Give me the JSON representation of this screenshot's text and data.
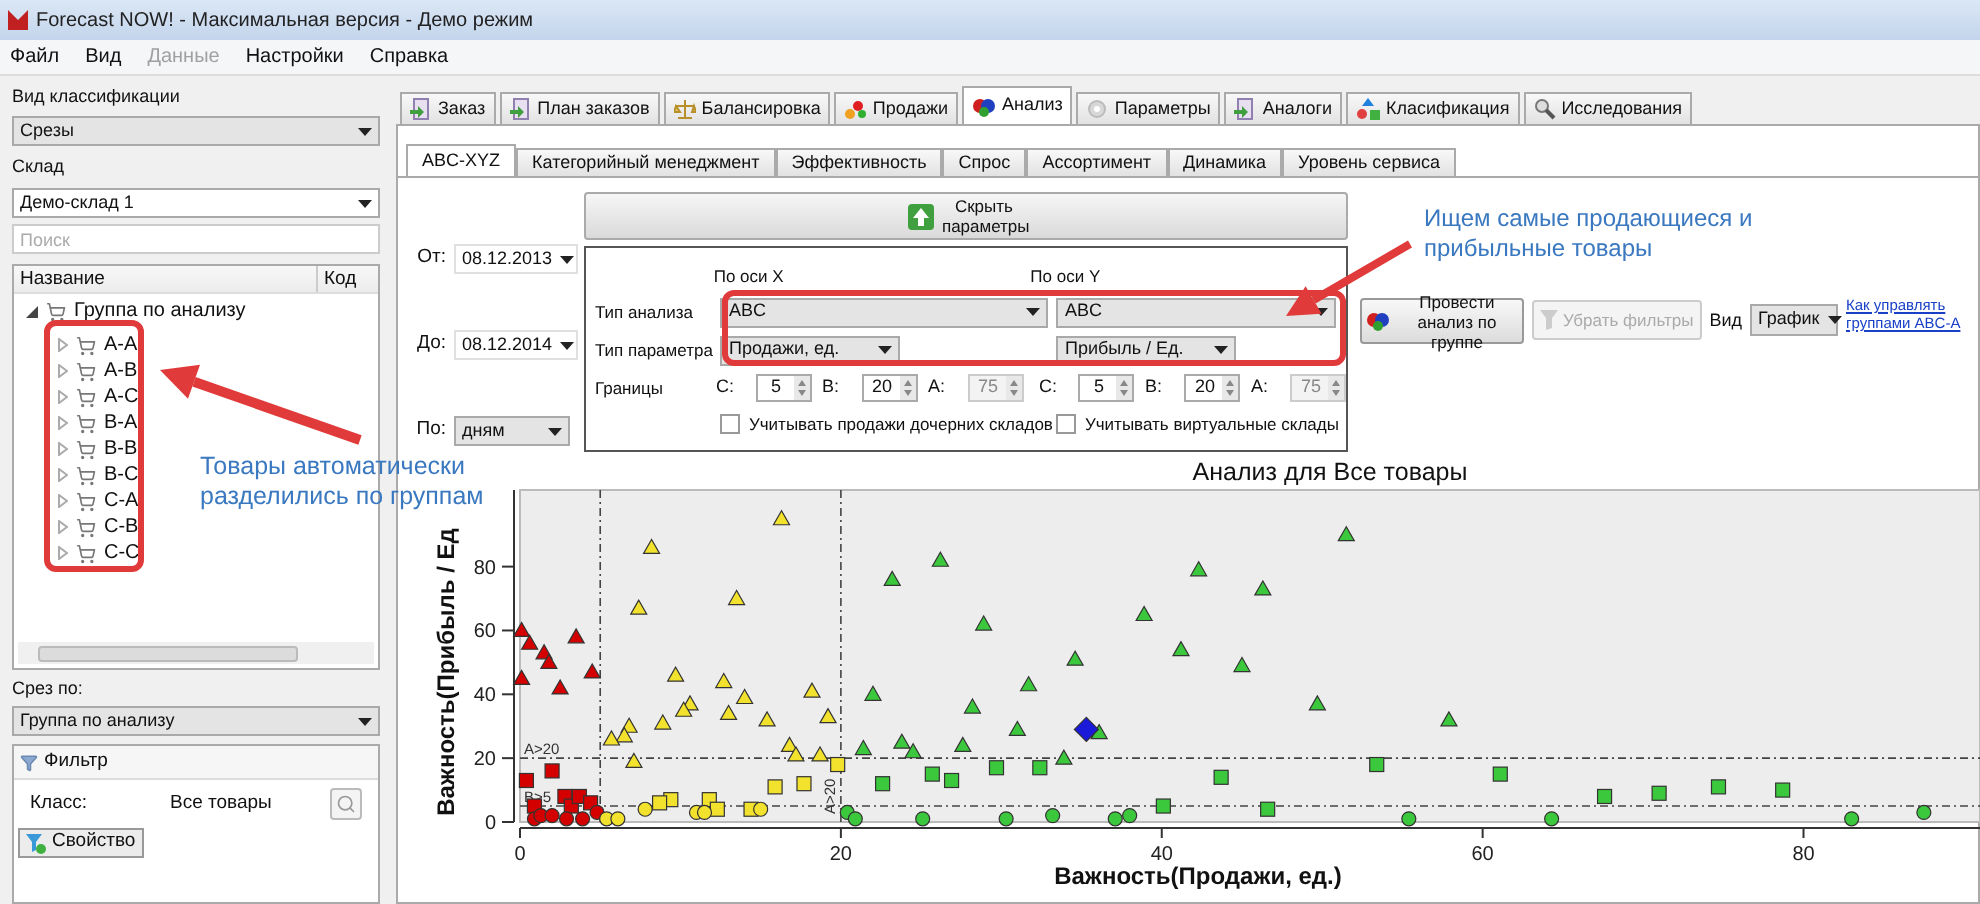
{
  "window": {
    "title": "Forecast NOW! - Максимальная версия - Демо режим"
  },
  "menu": [
    {
      "label": "Файл",
      "disabled": false
    },
    {
      "label": "Вид",
      "disabled": false
    },
    {
      "label": "Данные",
      "disabled": true
    },
    {
      "label": "Настройки",
      "disabled": false
    },
    {
      "label": "Справка",
      "disabled": false
    }
  ],
  "sidebar": {
    "classification": {
      "label": "Вид классификации",
      "value": "Срезы"
    },
    "warehouse": {
      "label": "Склад",
      "value": "Демо-склад 1"
    },
    "search": {
      "placeholder": "Поиск"
    },
    "tree": {
      "columns": [
        "Название",
        "Код"
      ],
      "items": [
        {
          "label": "Группа по анализу",
          "expanded": true,
          "children": [
            {
              "label": "A-A",
              "expanded": false
            },
            {
              "label": "A-B",
              "expanded": false
            },
            {
              "label": "A-C",
              "expanded": false
            },
            {
              "label": "B-A",
              "expanded": false
            },
            {
              "label": "B-B",
              "expanded": false
            },
            {
              "label": "B-C",
              "expanded": false
            },
            {
              "label": "C-A",
              "expanded": false
            },
            {
              "label": "C-B",
              "expanded": false
            },
            {
              "label": "C-C",
              "expanded": false
            }
          ]
        }
      ]
    },
    "slice": {
      "label": "Срез по:",
      "value": "Группа по анализу"
    },
    "filter": {
      "title": "Фильтр",
      "class_label": "Класс:",
      "class_value": "Все товары",
      "property_button": "Свойство"
    }
  },
  "tabs": [
    {
      "label": "Заказ",
      "selected": false
    },
    {
      "label": "План заказов",
      "selected": false
    },
    {
      "label": "Балансировка",
      "selected": false
    },
    {
      "label": "Продажи",
      "selected": false
    },
    {
      "label": "Анализ",
      "selected": true
    },
    {
      "label": "Параметры",
      "selected": false
    },
    {
      "label": "Аналоги",
      "selected": false
    },
    {
      "label": "Класификация",
      "selected": false
    },
    {
      "label": "Исследования",
      "selected": false
    }
  ],
  "subtabs": [
    {
      "label": "ABC-XYZ",
      "selected": true
    },
    {
      "label": "Категорийный менеджмент",
      "selected": false
    },
    {
      "label": "Эффективность",
      "selected": false
    },
    {
      "label": "Спрос",
      "selected": false
    },
    {
      "label": "Ассортимент",
      "selected": false
    },
    {
      "label": "Динамика",
      "selected": false
    },
    {
      "label": "Уровень сервиса",
      "selected": false
    }
  ],
  "period": [
    {
      "label": "От:",
      "value": "08.12.2013"
    },
    {
      "label": "До:",
      "value": "08.12.2014"
    },
    {
      "label": "По:",
      "value": "дням"
    }
  ],
  "hide_params_button": "Скрыть параметры",
  "row_labels": [
    "Тип анализа",
    "Тип параметра",
    "Границы"
  ],
  "axes": [
    {
      "header": "По оси X",
      "analysis": "ABC",
      "parameter": "Продажи, ед.",
      "bounds": [
        {
          "label": "C:",
          "value": "5",
          "disabled": false
        },
        {
          "label": "B:",
          "value": "20",
          "disabled": false
        },
        {
          "label": "A:",
          "value": "75",
          "disabled": true
        }
      ],
      "checkbox": {
        "label": "Учитывать продажи дочерних складов",
        "checked": false
      }
    },
    {
      "header": "По оси Y",
      "analysis": "ABC",
      "parameter": "Прибыль / Ед.",
      "bounds": [
        {
          "label": "C:",
          "value": "5",
          "disabled": false
        },
        {
          "label": "B:",
          "value": "20",
          "disabled": false
        },
        {
          "label": "A:",
          "value": "75",
          "disabled": true
        }
      ],
      "checkbox": {
        "label": "Учитывать виртуальные склады",
        "checked": false
      }
    }
  ],
  "actions": {
    "run_button": "Провести анализ по группе",
    "clear_button": {
      "label": "Убрать фильтры",
      "disabled": true
    },
    "view_label": "Вид",
    "view_value": "График",
    "help_link": "Как управлять группами ABC-A"
  },
  "callouts": [
    "Товары автоматически разделились по группам",
    "Ищем самые продающиеся и прибыльные товары"
  ],
  "chart": {
    "chart_data": {
      "type": "scatter",
      "title": "Анализ для Все товары",
      "xlabel": "Важность(Продажи, ед.)",
      "ylabel": "Важность(Прибыль / Ед",
      "xlim": [
        0,
        91
      ],
      "ylim": [
        0,
        104
      ],
      "xticks": [
        0,
        20,
        40,
        60,
        80
      ],
      "yticks": [
        0,
        20,
        40,
        60,
        80
      ],
      "ref_lines": [
        {
          "axis": "y",
          "value": 20,
          "label": "A>20"
        },
        {
          "axis": "y",
          "value": 5,
          "label": "B>5"
        },
        {
          "axis": "x",
          "value": 20,
          "label": "A>20"
        },
        {
          "axis": "x",
          "value": 5
        }
      ],
      "series": [
        {
          "color": "#d40000",
          "marker": "triangle",
          "x": [
            0.1,
            0.6,
            1.5,
            1.8,
            3.5,
            4.5,
            0.1,
            2.5
          ],
          "values": [
            60,
            56,
            53,
            50,
            58,
            47,
            45,
            42
          ]
        },
        {
          "color": "#d40000",
          "marker": "square",
          "x": [
            0.4,
            2,
            2.8,
            3.2,
            3.7,
            4.4,
            0.9
          ],
          "values": [
            13,
            16,
            8,
            5,
            8,
            6,
            5
          ]
        },
        {
          "color": "#d40000",
          "marker": "circle",
          "x": [
            0.9,
            1.3,
            2,
            2.9,
            3.9,
            4.8
          ],
          "values": [
            1,
            2,
            2,
            1,
            1,
            3
          ]
        },
        {
          "color": "#f2e22e",
          "marker": "triangle",
          "x": [
            8.2,
            16.3,
            7.4,
            13.5,
            9.7,
            12.7,
            14,
            10.6,
            10.2,
            13,
            18.2,
            19.2,
            8.9,
            6.8,
            6.5,
            5.7,
            15.4,
            16.8,
            17.2,
            18.7,
            7.1
          ],
          "values": [
            86,
            95,
            67,
            70,
            46,
            44,
            39,
            37,
            35,
            34,
            41,
            33,
            31,
            30,
            27,
            26,
            32,
            24,
            21,
            21,
            19
          ]
        },
        {
          "color": "#f2e22e",
          "marker": "square",
          "x": [
            19.8,
            15.9,
            17.7,
            9.4,
            8.7,
            11.8,
            12.3,
            14.4
          ],
          "values": [
            18,
            11,
            12,
            7,
            6,
            7,
            4,
            4
          ]
        },
        {
          "color": "#f2e22e",
          "marker": "circle",
          "x": [
            5.4,
            6.1,
            7.8,
            11,
            11.5,
            15
          ],
          "values": [
            1,
            1,
            4,
            3,
            3,
            4
          ]
        },
        {
          "color": "#3cc83c",
          "marker": "triangle",
          "x": [
            23.2,
            26.2,
            28.9,
            22,
            21.4,
            23.8,
            24.5,
            28.2,
            27.6,
            31.7,
            31,
            34.6,
            33.9,
            36.1,
            38.9,
            41.2,
            42.3,
            45,
            46.3,
            49.7,
            51.5,
            57.9
          ],
          "values": [
            76,
            82,
            62,
            40,
            23,
            25,
            22,
            36,
            24,
            43,
            29,
            51,
            20,
            28,
            65,
            54,
            79,
            49,
            73,
            37,
            90,
            32
          ]
        },
        {
          "color": "#3cc83c",
          "marker": "square",
          "x": [
            22.6,
            25.7,
            26.9,
            29.7,
            32.4,
            40.1,
            43.7,
            46.6,
            53.4,
            61.1,
            67.6,
            71,
            74.7,
            78.7
          ],
          "values": [
            12,
            15,
            13,
            17,
            17,
            5,
            14,
            4,
            18,
            15,
            8,
            9,
            11,
            10
          ]
        },
        {
          "color": "#3cc83c",
          "marker": "circle",
          "x": [
            20.4,
            20.9,
            25.1,
            30.3,
            33.2,
            37.1,
            38,
            55.4,
            64.3,
            83,
            87.5
          ],
          "values": [
            3,
            1,
            1,
            1,
            2,
            1,
            2,
            1,
            1,
            1,
            3
          ]
        },
        {
          "color": "#1a1ad8",
          "marker": "diamond",
          "x": [
            35.3
          ],
          "values": [
            29
          ]
        }
      ]
    }
  }
}
